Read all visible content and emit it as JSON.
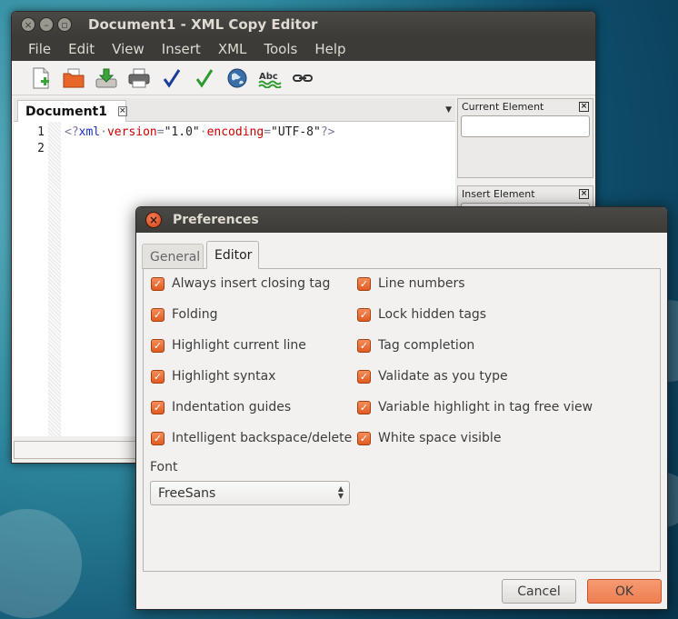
{
  "main_window": {
    "title": "Document1 - XML Copy Editor",
    "menu": [
      "File",
      "Edit",
      "View",
      "Insert",
      "XML",
      "Tools",
      "Help"
    ],
    "toolbar_icons": [
      "new-document-icon",
      "open-folder-icon",
      "save-download-icon",
      "print-icon",
      "check-wellformed-icon",
      "validate-icon",
      "browser-globe-icon",
      "spellcheck-abc-icon",
      "link-chain-icon"
    ],
    "tab": {
      "label": "Document1"
    },
    "line_numbers": [
      "1",
      "2"
    ],
    "code": {
      "open": "<?",
      "name": "xml",
      "dot1": "·",
      "attr1": "version",
      "eq1": "=",
      "val1": "\"1.0\"",
      "dot2": "·",
      "attr2": "encoding",
      "eq2": "=",
      "val2": "\"UTF-8\"",
      "close": "?>"
    },
    "panes": {
      "current_element": "Current Element",
      "insert_element": "Insert Element"
    }
  },
  "dialog": {
    "title": "Preferences",
    "tabs": {
      "general": "General",
      "editor": "Editor"
    },
    "options_left": [
      "Always insert closing tag",
      "Folding",
      "Highlight current line",
      "Highlight syntax",
      "Indentation guides",
      "Intelligent backspace/delete"
    ],
    "options_right": [
      "Line numbers",
      "Lock hidden tags",
      "Tag completion",
      "Validate as you type",
      "Variable highlight in tag free view",
      "White space visible"
    ],
    "font_label": "Font",
    "font_value": "FreeSans",
    "cancel": "Cancel",
    "ok": "OK"
  },
  "colors": {
    "accent": "#e8642c",
    "titlebar": "#3c3b37",
    "xml_name": "#1a2fc8",
    "xml_attr": "#c80000"
  }
}
